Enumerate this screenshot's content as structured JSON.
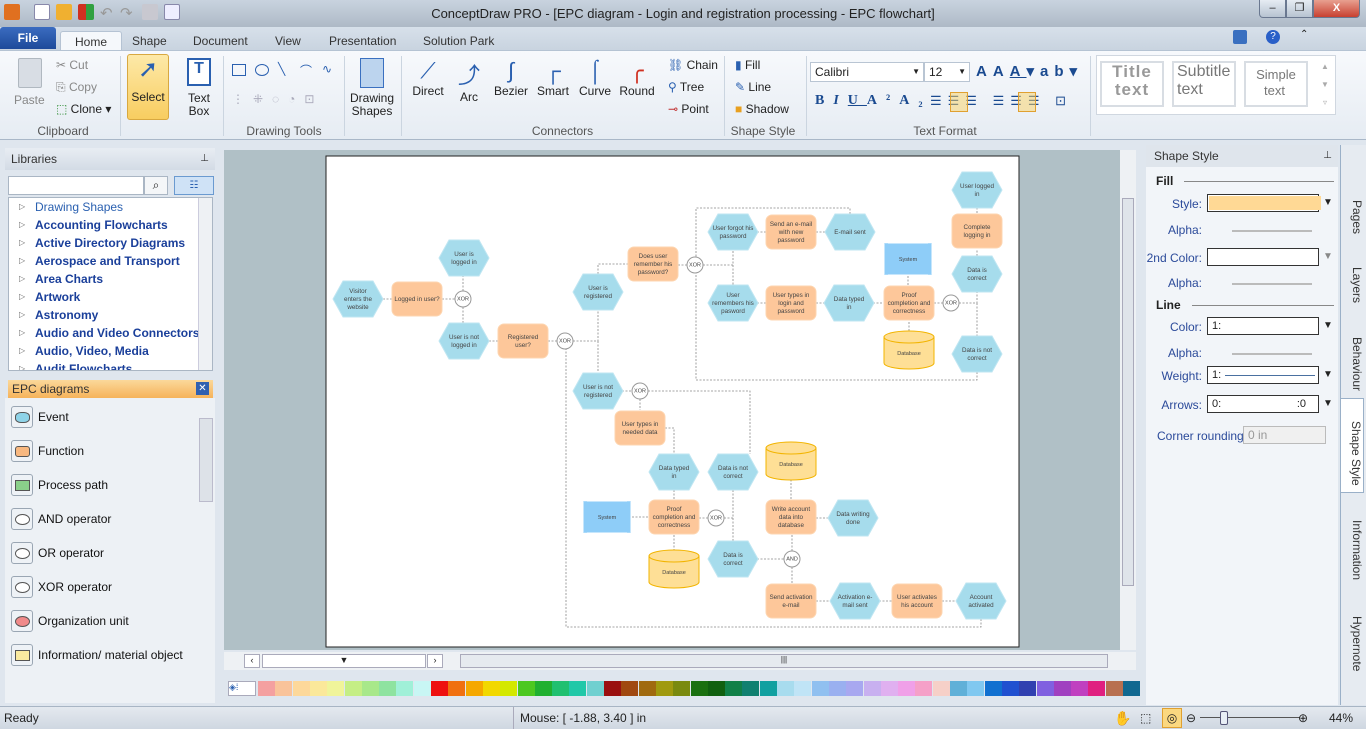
{
  "window": {
    "title": "ConceptDraw PRO - [EPC diagram - Login and registration processing - EPC flowchart]",
    "minimize": "–",
    "restore": "❐",
    "close": "X"
  },
  "menu": {
    "file": "File",
    "tabs": [
      "Home",
      "Shape",
      "Document",
      "View",
      "Presentation",
      "Solution Park"
    ]
  },
  "ribbon": {
    "clipboard": {
      "paste": "Paste",
      "cut": "Cut",
      "copy": "Copy",
      "clone": "Clone",
      "group": "Clipboard"
    },
    "select": "Select",
    "text_box": [
      "Text",
      "Box"
    ],
    "drawing_tools": "Drawing Tools",
    "drawing_shapes": [
      "Drawing",
      "Shapes"
    ],
    "connectors": {
      "items": [
        "Direct",
        "Arc",
        "Bezier",
        "Smart",
        "Curve",
        "Round"
      ],
      "chain": "Chain",
      "tree": "Tree",
      "point": "Point",
      "group": "Connectors"
    },
    "shape_style": {
      "fill": "Fill",
      "line": "Line",
      "shadow": "Shadow",
      "group": "Shape Style"
    },
    "text_format": {
      "font": "Calibri",
      "size": "12",
      "group": "Text Format"
    },
    "styles": [
      [
        "Title",
        "text"
      ],
      [
        "Subtitle",
        "text"
      ],
      [
        "Simple",
        "text"
      ]
    ]
  },
  "libraries": {
    "title": "Libraries",
    "search_placeholder": "",
    "items": [
      "Drawing Shapes",
      "Accounting Flowcharts",
      "Active Directory Diagrams",
      "Aerospace and Transport",
      "Area Charts",
      "Artwork",
      "Astronomy",
      "Audio and Video Connectors",
      "Audio, Video, Media",
      "Audit Flowcharts"
    ]
  },
  "epc": {
    "title": "EPC diagrams",
    "items": [
      "Event",
      "Function",
      "Process path",
      "AND operator",
      "OR operator",
      "XOR operator",
      "Organization unit",
      "Information/ material object"
    ]
  },
  "diagram": {
    "events": [
      [
        "Visitor",
        "enters the",
        "website"
      ],
      [
        "User is",
        "logged in"
      ],
      [
        "User is not",
        "logged in"
      ],
      [
        "User is",
        "registered"
      ],
      [
        "User is not",
        "registered"
      ],
      [
        "User forgot his",
        "password"
      ],
      [
        "E-mail sent"
      ],
      [
        "User",
        "remembers his",
        "pasword"
      ],
      [
        "Data typed",
        "in"
      ],
      [
        "User logged",
        "in"
      ],
      [
        "Data is",
        "correct"
      ],
      [
        "Data is not",
        "correct"
      ],
      [
        "Data typed",
        "in"
      ],
      [
        "Data is not",
        "correct"
      ],
      [
        "Data is",
        "correct"
      ],
      [
        "Data writing",
        "done"
      ],
      [
        "Activation e-",
        "mail sent"
      ],
      [
        "Account",
        "activated"
      ]
    ],
    "functions": [
      [
        "Logged in user?"
      ],
      [
        "Registered",
        "user?"
      ],
      [
        "Does user",
        "remember his",
        "password?"
      ],
      [
        "Send an e-mail",
        "with new",
        "password"
      ],
      [
        "User types in",
        "login and",
        "password"
      ],
      [
        "Proof",
        "completion and",
        "correctness"
      ],
      [
        "Complete",
        "logging in"
      ],
      [
        "User types in",
        "needed data"
      ],
      [
        "Proof",
        "completion and",
        "correctness"
      ],
      [
        "Write account",
        "data into",
        "database"
      ],
      [
        "Send activation",
        "e-mail"
      ],
      [
        "User activates",
        "his account"
      ]
    ],
    "operators": [
      "XOR",
      "XOR",
      "XOR",
      "XOR",
      "XOR",
      "XOR",
      "AND"
    ],
    "systems": [
      "System",
      "System"
    ],
    "databases": [
      "Database",
      "Database",
      "Database"
    ]
  },
  "shape_style_panel": {
    "title": "Shape Style",
    "fill": "Fill",
    "style": "Style:",
    "alpha": "Alpha:",
    "second_color": "2nd Color:",
    "line": "Line",
    "color": "Color:",
    "color_value": "1:",
    "weight": "Weight:",
    "weight_value": "1:",
    "arrows": "Arrows:",
    "arrows_value": "0:",
    "arrows_end": ":0",
    "corner_rounding": "Corner rounding:",
    "corner_value": "0 in",
    "fill_color": "#ffd995"
  },
  "side_tabs": [
    "Pages",
    "Layers",
    "Behaviour",
    "Shape Style",
    "Information",
    "Hypernote"
  ],
  "palette": [
    "#f4a0a0",
    "#f9c39a",
    "#fdd89a",
    "#fbe89a",
    "#f0f49a",
    "#c5ee85",
    "#a8e88a",
    "#8ee3a0",
    "#a0f0d8",
    "#c8f6f4",
    "#ee1010",
    "#f07010",
    "#f5a800",
    "#f2d800",
    "#d4e800",
    "#4cc820",
    "#20b030",
    "#20c070",
    "#20c8a8",
    "#70d0d0",
    "#9a1010",
    "#a04810",
    "#a06a10",
    "#a09a10",
    "#7a8a10",
    "#1a7010",
    "#106010",
    "#108048",
    "#108070",
    "#10a0a0",
    "#a8dcee",
    "#c0e4f6",
    "#90c0f0",
    "#9ab0f0",
    "#a8a8f0",
    "#c8b0f0",
    "#e0b0f0",
    "#f0a0e8",
    "#f5a0c8",
    "#f6d0c8",
    "#60b0d8",
    "#80c8f0",
    "#1070d0",
    "#2050d0",
    "#3040b0",
    "#8060e0",
    "#a040c0",
    "#c040c0",
    "#e02080",
    "#b87050",
    "#106890"
  ],
  "status": {
    "ready": "Ready",
    "mouse": "Mouse: [ -1.88, 3.40 ] in",
    "zoom": "44%"
  }
}
